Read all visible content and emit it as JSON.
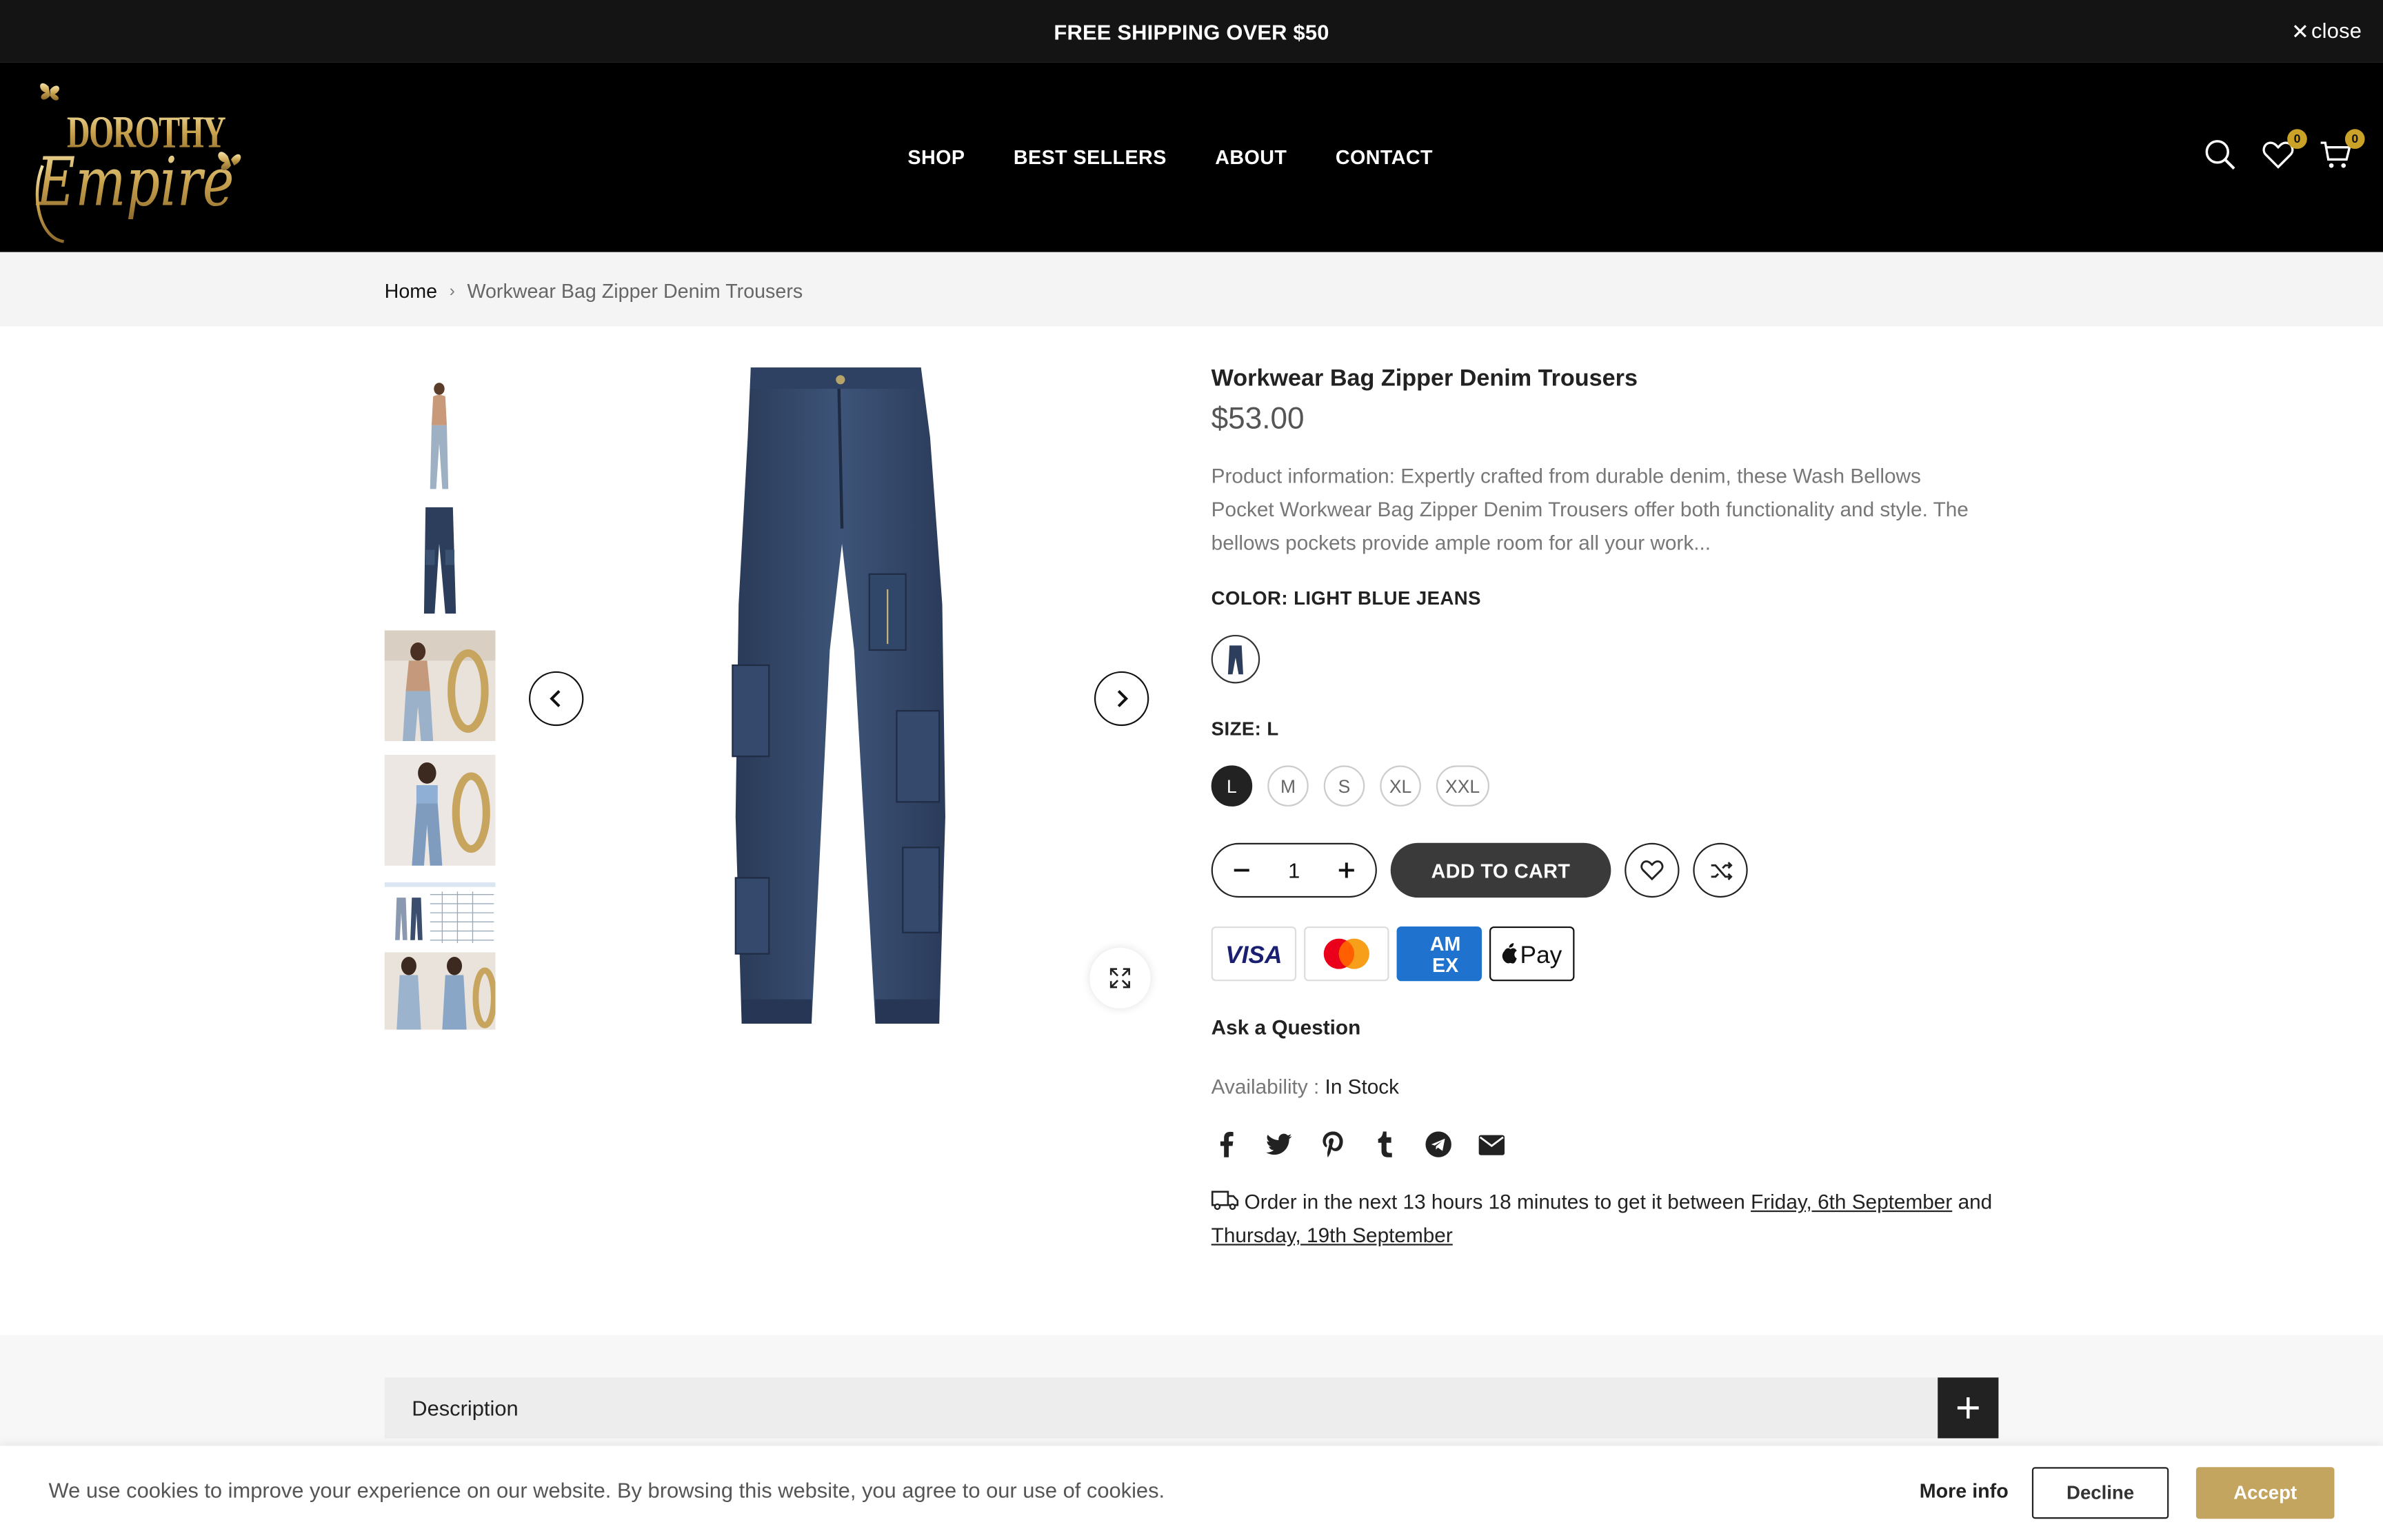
{
  "announcement": {
    "text": "FREE SHIPPING OVER $50",
    "close_label": "close"
  },
  "brand": {
    "line1": "DOROTHY",
    "line2": "Empire"
  },
  "nav": {
    "items": [
      "SHOP",
      "BEST SELLERS",
      "ABOUT",
      "CONTACT"
    ]
  },
  "header_icons": {
    "wishlist_count": "0",
    "cart_count": "0"
  },
  "breadcrumb": {
    "home": "Home",
    "current": "Workwear Bag Zipper Denim Trousers"
  },
  "product": {
    "title": "Workwear Bag Zipper Denim Trousers",
    "price": "$53.00",
    "description": "Product information: Expertly crafted from durable denim, these Wash Bellows Pocket Workwear Bag Zipper Denim Trousers offer both functionality and style. The bellows pockets provide ample room for all your work...",
    "color_label": "COLOR: LIGHT BLUE JEANS",
    "size_label": "SIZE: L",
    "sizes": [
      "L",
      "M",
      "S",
      "XL",
      "XXL"
    ],
    "selected_size": "L",
    "quantity": "1",
    "add_to_cart": "ADD TO CART",
    "ask_question": "Ask a Question",
    "availability_label": "Availability :",
    "availability_value": "In Stock"
  },
  "payments": {
    "visa": "VISA",
    "amex_top": "AM",
    "amex_bottom": "EX",
    "applepay": "Pay"
  },
  "delivery": {
    "prefix": "Order in the next 13 hours 18 minutes to get it between",
    "date1": "Friday, 6th September",
    "and": "and",
    "date2": "Thursday, 19th September"
  },
  "tabs": {
    "description": "Description"
  },
  "cookie": {
    "message": "We use cookies to improve your experience on our website. By browsing this website, you agree to our use of cookies.",
    "more_info": "More info",
    "decline": "Decline",
    "accept": "Accept"
  },
  "colors": {
    "accent_gold": "#c4a560",
    "badge_gold": "#c9a227",
    "dark": "#141414"
  }
}
